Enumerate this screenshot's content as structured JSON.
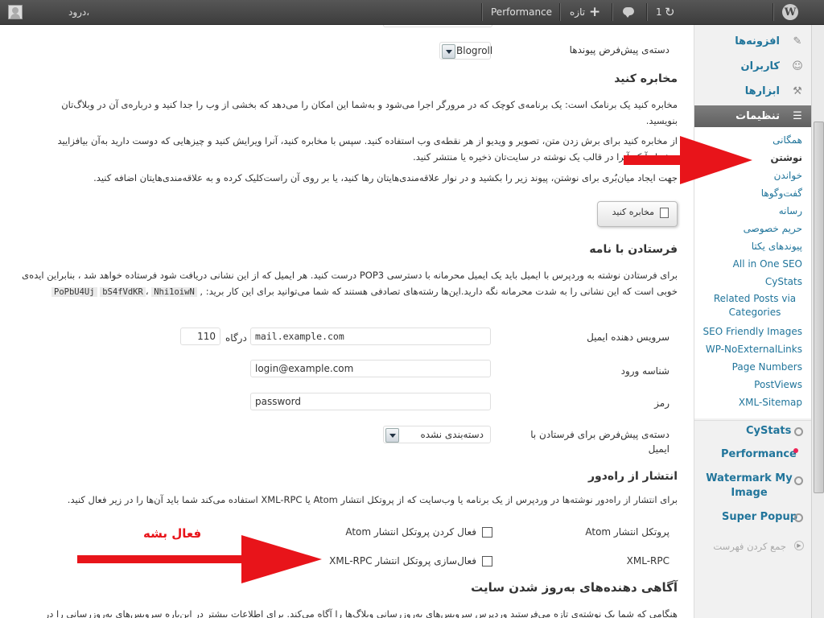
{
  "admin_bar": {
    "greeting": "درود،",
    "performance": "Performance",
    "new_label": "تازه",
    "updates_count": "1"
  },
  "main": {
    "blogroll_row": {
      "label": "دسته‌ی پیش‌فرض پیوندها",
      "value": "Blogroll"
    },
    "press_this": {
      "title": "مخابره کنید",
      "p1": "مخابره کنید یک برنامک است: یک برنامه‌ی کوچک که در مرورگر اجرا می‌شود و به‌شما این امکان را می‌دهد که بخشی از وب را جدا کنید و درباره‌ی آن در وبلاگ‌تان بنویسید.",
      "p2": "از مخابره کنید برای برش زدن متن، تصویر و ویدیو از هر نقطه‌ی وب استفاده کنید. سپس با مخابره کنید، آنرا ویرایش کنید و چیزهایی که دوست دارید به‌آن بیافزایید پیش از آنکه آنرا در قالب یک نوشته در سایت‌تان ذخیره یا منتشر کنید.",
      "p3": "جهت ایجاد میان‌بُری برای نوشتن، پیوند زیر را بکشید و در نوار علاقه‌مندی‌هایتان رها کنید، یا بر روی آن راست‌کلیک کرده و به علاقه‌مندی‌هایتان اضافه کنید.",
      "button": "مخابره کنید"
    },
    "post_via_email": {
      "title": "فرستادن با نامه",
      "p1": "برای فرستادن نوشته به وردپرس با ایمیل باید یک ایمیل محرمانه با دسترسی POP3 درست کنید. هر ایمیل که از این نشانی دریافت شود فرستاده خواهد شد ، بنابراین ایده‌ی خوبی است که این نشانی را به شدت محرمانه نگه دارید.این‌ها رشته‌های تصادفی هستند که شما می‌توانید برای این کار برید: ,",
      "code1": "PoPbU4Uj",
      "code2": "bS4fVdKR",
      "code3": "Nhi1oiwN",
      "code_sep": "،",
      "mail_server_label": "سرویس دهنده ایمیل",
      "mail_server_value": "mail.example.com",
      "port_label": "درگاه",
      "port_value": "110",
      "login_label": "شناسه ورود",
      "login_value": "login@example.com",
      "password_label": "رمز",
      "password_value": "password",
      "category_label": "دسته‌ی پیش‌فرض برای فرستادن با ایمیل",
      "category_value": "دسته‌بندی نشده"
    },
    "remote_publishing": {
      "title": "انتشار از راه‌دور",
      "p1": "برای انتشار از راه‌دور نوشته‌ها در وردپرس از یک برنامه یا وب‌سایت که از پروتکل انتشار Atom یا XML-RPC استفاده می‌کند شما باید آن‌ها را در زیر فعال کنید.",
      "atom_label": "پروتکل انتشار Atom",
      "atom_checkbox": "فعال کردن پروتکل انتشار Atom",
      "xmlrpc_label": "XML-RPC",
      "xmlrpc_checkbox": "فعال‌سازی پروتکل انتشار XML-RPC",
      "annotation": "فعال بشه"
    },
    "update_services": {
      "title": "آگاهی دهنده‌های به‌روز شدن سایت",
      "p1": "هنگامی که شما یک نوشته‌ی تازه می‌فرستید وردپرس سرویس‌های به‌روزرسانی وبلاگ‌ها را آگاه می‌کند. برای اطلاعات بیشتر در این‌باره سرویس‌های به‌روزرسانی را در"
    }
  },
  "sidebar": {
    "top_items": [
      {
        "label": "افزونه‌ها",
        "icon": "plugin-icon"
      },
      {
        "label": "کاربران",
        "icon": "users-icon"
      },
      {
        "label": "ابزارها",
        "icon": "tools-icon"
      }
    ],
    "settings": {
      "label": "تنظیمات",
      "icon": "settings-icon"
    },
    "settings_submenu": [
      "همگانی",
      "نوشتن",
      "خواندن",
      "گفت‌وگوها",
      "رسانه",
      "حریم خصوصی",
      "پیوندهای یکتا",
      "All in One SEO",
      "CyStats",
      "Related Posts via Categories",
      "SEO Friendly Images",
      "WP-NoExternalLinks",
      "Page Numbers",
      "PostViews",
      "XML-Sitemap"
    ],
    "plugin_menus": [
      {
        "label": "CyStats",
        "icon": "cystats-icon"
      },
      {
        "label": "Performance",
        "icon": "performance-icon"
      },
      {
        "label": "Watermark My Image",
        "icon": "watermark-icon"
      },
      {
        "label": "Super Popup",
        "icon": "popup-icon"
      }
    ],
    "collapse": "جمع کردن فهرست"
  },
  "colors": {
    "admin_bar": "#464646",
    "link": "#21759b",
    "settings_active": "#6d6d6d",
    "annotation_red": "#e8141a"
  }
}
